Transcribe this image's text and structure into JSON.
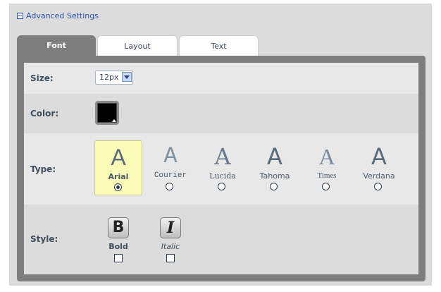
{
  "header": {
    "advanced_label": "Advanced Settings"
  },
  "tabs": [
    {
      "label": "Font",
      "active": true
    },
    {
      "label": "Layout",
      "active": false
    },
    {
      "label": "Text",
      "active": false
    }
  ],
  "size": {
    "label": "Size:",
    "value": "12px"
  },
  "color": {
    "label": "Color:",
    "value": "#000000"
  },
  "type": {
    "label": "Type:",
    "options": [
      {
        "name": "Arial",
        "glyph": "A",
        "selected": true
      },
      {
        "name": "Courier",
        "glyph": "A",
        "selected": false
      },
      {
        "name": "Lucida",
        "glyph": "A",
        "selected": false
      },
      {
        "name": "Tahoma",
        "glyph": "A",
        "selected": false
      },
      {
        "name": "Times",
        "glyph": "A",
        "selected": false
      },
      {
        "name": "Verdana",
        "glyph": "A",
        "selected": false
      }
    ]
  },
  "style": {
    "label": "Style:",
    "options": [
      {
        "name": "Bold",
        "glyph": "B",
        "checked": false
      },
      {
        "name": "Italic",
        "glyph": "I",
        "checked": false
      }
    ]
  }
}
